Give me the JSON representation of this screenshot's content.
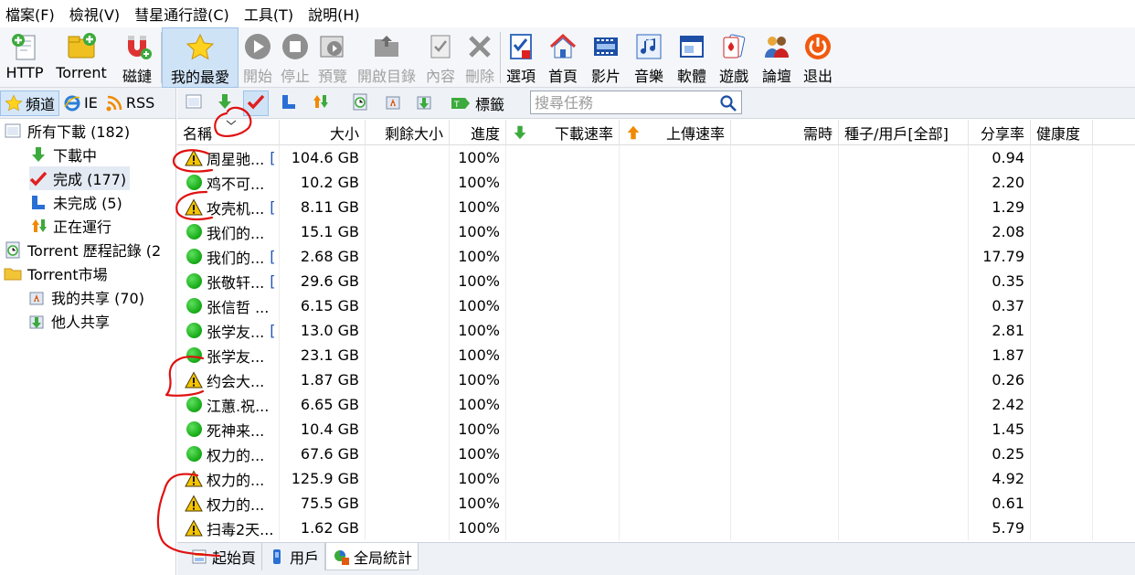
{
  "menu": [
    "檔案(F)",
    "檢視(V)",
    "彗星通行證(C)",
    "工具(T)",
    "說明(H)"
  ],
  "toolbar": {
    "http": "HTTP",
    "torrent": "Torrent",
    "magnet": "磁鏈",
    "favorites": "我的最愛",
    "start": "開始",
    "stop": "停止",
    "preview": "預覽",
    "open_folder": "開啟目錄",
    "content": "內容",
    "delete": "刪除",
    "options": "選項",
    "home": "首頁",
    "video": "影片",
    "music": "音樂",
    "software": "軟體",
    "games": "遊戲",
    "forum": "論壇",
    "exit": "退出"
  },
  "left_tabs": {
    "channel": "頻道",
    "ie": "IE",
    "rss": "RSS"
  },
  "tree": {
    "all": "所有下載 (182)",
    "downloading": "下載中",
    "completed": "完成 (177)",
    "incomplete": "未完成 (5)",
    "running": "正在運行",
    "history": "Torrent 歷程記錄 (2",
    "market": "Torrent市場",
    "my_shares": "我的共享 (70)",
    "others_shares": "他人共享"
  },
  "right_toolbar": {
    "tags_label": "標籤",
    "search_placeholder": "搜尋任務"
  },
  "columns": {
    "name": "名稱",
    "size": "大小",
    "remaining": "剩餘大小",
    "progress": "進度",
    "down_speed": "下載速率",
    "up_speed": "上傳速率",
    "time": "需時",
    "seeds": "種子/用戶[全部]",
    "ratio": "分享率",
    "health": "健康度"
  },
  "rows": [
    {
      "status": "warning",
      "name": "周星驰...",
      "mark": "[",
      "size": "104.6 GB",
      "progress": "100%",
      "ratio": "0.94"
    },
    {
      "status": "ok",
      "name": "鸡不可...",
      "mark": "",
      "size": "10.2 GB",
      "progress": "100%",
      "ratio": "2.20"
    },
    {
      "status": "warning",
      "name": "攻壳机...",
      "mark": "[",
      "size": "8.11 GB",
      "progress": "100%",
      "ratio": "1.29"
    },
    {
      "status": "ok",
      "name": "我们的...",
      "mark": "",
      "size": "15.1 GB",
      "progress": "100%",
      "ratio": "2.08"
    },
    {
      "status": "ok",
      "name": "我们的...",
      "mark": "[",
      "size": "2.68 GB",
      "progress": "100%",
      "ratio": "17.79"
    },
    {
      "status": "ok",
      "name": "张敬轩...",
      "mark": "[",
      "size": "29.6 GB",
      "progress": "100%",
      "ratio": "0.35"
    },
    {
      "status": "ok",
      "name": "张信哲 ...",
      "mark": "",
      "size": "6.15 GB",
      "progress": "100%",
      "ratio": "0.37"
    },
    {
      "status": "ok",
      "name": "张学友...",
      "mark": "[",
      "size": "13.0 GB",
      "progress": "100%",
      "ratio": "2.81"
    },
    {
      "status": "ok",
      "name": "张学友...",
      "mark": "",
      "size": "23.1 GB",
      "progress": "100%",
      "ratio": "1.87"
    },
    {
      "status": "warning",
      "name": "约会大...",
      "mark": "",
      "size": "1.87 GB",
      "progress": "100%",
      "ratio": "0.26"
    },
    {
      "status": "ok",
      "name": "江蕙.祝...",
      "mark": "",
      "size": "6.65 GB",
      "progress": "100%",
      "ratio": "2.42"
    },
    {
      "status": "ok",
      "name": "死神来...",
      "mark": "",
      "size": "10.4 GB",
      "progress": "100%",
      "ratio": "1.45"
    },
    {
      "status": "ok",
      "name": "权力的...",
      "mark": "",
      "size": "67.6 GB",
      "progress": "100%",
      "ratio": "0.25"
    },
    {
      "status": "warning",
      "name": "权力的...",
      "mark": "",
      "size": "125.9 GB",
      "progress": "100%",
      "ratio": "4.92"
    },
    {
      "status": "warning",
      "name": "权力的...",
      "mark": "",
      "size": "75.5 GB",
      "progress": "100%",
      "ratio": "0.61"
    },
    {
      "status": "warning",
      "name": "扫毒2天...",
      "mark": "",
      "size": "1.62 GB",
      "progress": "100%",
      "ratio": "5.79"
    }
  ],
  "bottom_tabs": {
    "start_page": "起始頁",
    "users": "用戶",
    "global_stats": "全局統計"
  },
  "colors": {
    "annotation": "#e01010",
    "selection": "#cfe3f7",
    "ok_dot": "#22b322",
    "warning": "#f5c400"
  }
}
